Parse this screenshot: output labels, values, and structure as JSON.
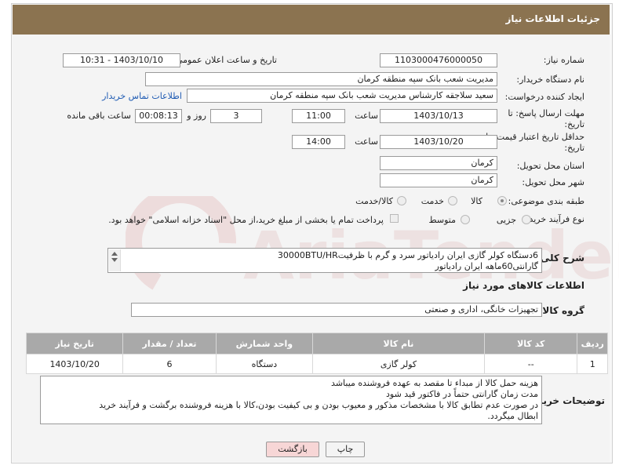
{
  "header": {
    "title": "جزئیات اطلاعات نیاز"
  },
  "fields": {
    "need_number": {
      "label": "شماره نیاز:",
      "value": "1103000476000050"
    },
    "announce_datetime": {
      "label": "تاریخ و ساعت اعلان عمومی:",
      "value": "1403/10/10 - 10:31"
    },
    "buyer_org": {
      "label": "نام دستگاه خریدار:",
      "value": "مدیریت شعب بانک سپه منطقه کرمان"
    },
    "requester": {
      "label": "ایجاد کننده درخواست:",
      "value": "سعید سلاجقه کارشناس مدیریت شعب بانک سپه منطقه کرمان",
      "contact_link": "اطلاعات تماس خریدار"
    },
    "deadline": {
      "label_line1": "مهلت ارسال پاسخ: تا",
      "label_line2": "تاریخ:",
      "date": "1403/10/13",
      "time_label": "ساعت",
      "time": "11:00",
      "days": "3",
      "days_label": "روز و",
      "remaining": "00:08:13",
      "remaining_label": "ساعت باقی مانده"
    },
    "price_validity": {
      "label_line1": "حداقل تاریخ اعتبار قیمت: تا",
      "label_line2": "تاریخ:",
      "date": "1403/10/20",
      "time_label": "ساعت",
      "time": "14:00"
    },
    "province": {
      "label": "استان محل تحویل:",
      "value": "کرمان"
    },
    "city": {
      "label": "شهر محل تحویل:",
      "value": "کرمان"
    },
    "category": {
      "label": "طبقه بندی موضوعی:",
      "options": [
        {
          "label": "کالا",
          "checked": true
        },
        {
          "label": "خدمت",
          "checked": false
        },
        {
          "label": "کالا/خدمت",
          "checked": false
        }
      ]
    },
    "purchase_process": {
      "label": "نوع فرآیند خرید :",
      "options": [
        {
          "label": "جزیی",
          "checked": false
        },
        {
          "label": "متوسط",
          "checked": false
        }
      ],
      "payment_note": "پرداخت تمام یا بخشی از مبلغ خرید،از محل \"اسناد خزانه اسلامی\" خواهد بود."
    },
    "description": {
      "label": "شرح کلی نیاز:",
      "line1": "6دستگاه کولر گازی ایران رادیاتور سرد و گرم با ظرفیت30000BTU/HR",
      "line2": "گارانتی60ماهه ایران رادیاتور"
    }
  },
  "goods_section": {
    "title": "اطلاعات کالاهای مورد نیاز",
    "group_label": "گروه کالا:",
    "group_value": "تجهیزات خانگی، اداری و صنعتی"
  },
  "table": {
    "headers": [
      "ردیف",
      "کد کالا",
      "نام کالا",
      "واحد شمارش",
      "تعداد / مقدار",
      "تاریخ نیاز"
    ],
    "rows": [
      [
        "1",
        "--",
        "کولر گازی",
        "دستگاه",
        "6",
        "1403/10/20"
      ]
    ]
  },
  "buyer_notes": {
    "label": "توضیحات خریدار:",
    "lines": [
      "هزینه حمل کالا از مبداء تا مقصد به عهده فروشنده میباشد",
      "مدت زمان گارانتی حتماً در فاکتور قید شود",
      "در صورت عدم تطابق کالا با مشخصات مذکور و معیوب بودن و بی کیفیت بودن،کالا با هزینه فروشنده برگشت و فرآیند خرید",
      "ابطال میگردد."
    ]
  },
  "buttons": {
    "print": "چاپ",
    "back": "بازگشت"
  },
  "colors": {
    "header_bg": "#8b7350",
    "table_header_bg": "#a9a9a9",
    "link": "#1f5bb3",
    "back_button_bg": "#f7d6d6"
  },
  "watermark": {
    "text": "AriaTender.neT"
  }
}
